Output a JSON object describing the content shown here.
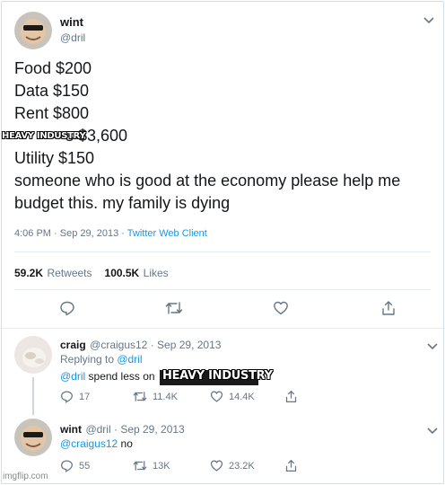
{
  "tweet": {
    "author_name": "wint",
    "author_handle": "@dril",
    "lines": [
      "Food $200",
      "Data $150",
      "Rent $800",
      "s $3,600",
      "Utility $150",
      "someone who is good at the economy please help me",
      "budget this. my family is dying"
    ],
    "overlay_text": "HEAVY INDUSTRY",
    "time": "4:06 PM · Sep 29, 2013 · ",
    "client": "Twitter Web Client",
    "retweets_count": "59.2K",
    "retweets_label": "Retweets",
    "likes_count": "100.5K",
    "likes_label": "Likes"
  },
  "replies": [
    {
      "name": "craig",
      "handle": "@craigus12",
      "sep": " · ",
      "date": "Sep 29, 2013",
      "replying_prefix": "Replying to ",
      "replying_handle": "@dril",
      "mention": "@dril",
      "text": " spend less on ",
      "overlay_text": "HEAVY INDUSTRY",
      "replies": "17",
      "retweets": "11.4K",
      "likes": "14.4K"
    },
    {
      "name": "wint",
      "handle": "@dril",
      "sep": " · ",
      "date": "Sep 29, 2013",
      "mention": "@craigus12",
      "text": " no",
      "replies": "55",
      "retweets": "13K",
      "likes": "23.2K"
    }
  ],
  "watermark": "imgflip.com",
  "icons": [
    "reply-icon",
    "retweet-icon",
    "like-icon",
    "share-icon",
    "chevron-down-icon"
  ],
  "colors": {
    "link": "#1b95e0",
    "muted": "#657786",
    "text": "#14171a",
    "divider": "#e6ecf0"
  }
}
